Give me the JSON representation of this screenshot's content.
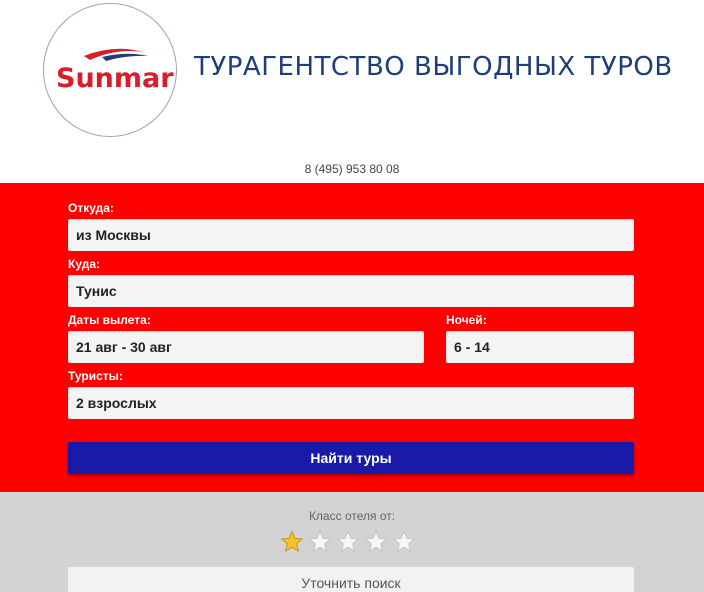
{
  "header": {
    "logo_text": "Sunmar",
    "agency_title": "ТУРАГЕНТСТВО ВЫГОДНЫХ ТУРОВ",
    "phone": "8 (495) 953 80 08"
  },
  "search_form": {
    "from_label": "Откуда:",
    "from_value": "из Москвы",
    "to_label": "Куда:",
    "to_value": "Тунис",
    "dates_label": "Даты вылета:",
    "dates_value": "21 авг - 30 авг",
    "nights_label": "Ночей:",
    "nights_value": "6 - 14",
    "tourists_label": "Туристы:",
    "tourists_value": "2 взрослых",
    "submit_label": "Найти туры"
  },
  "filters": {
    "hotel_class_label": "Класс отеля от:",
    "stars_total": 5,
    "stars_selected": 1,
    "refine_label": "Уточнить поиск"
  },
  "colors": {
    "panel_red": "#ff0000",
    "button_blue": "#1a1aa8",
    "title_blue": "#1d3e78",
    "star_gold": "#f2c230",
    "star_empty": "#f7f7f7"
  }
}
